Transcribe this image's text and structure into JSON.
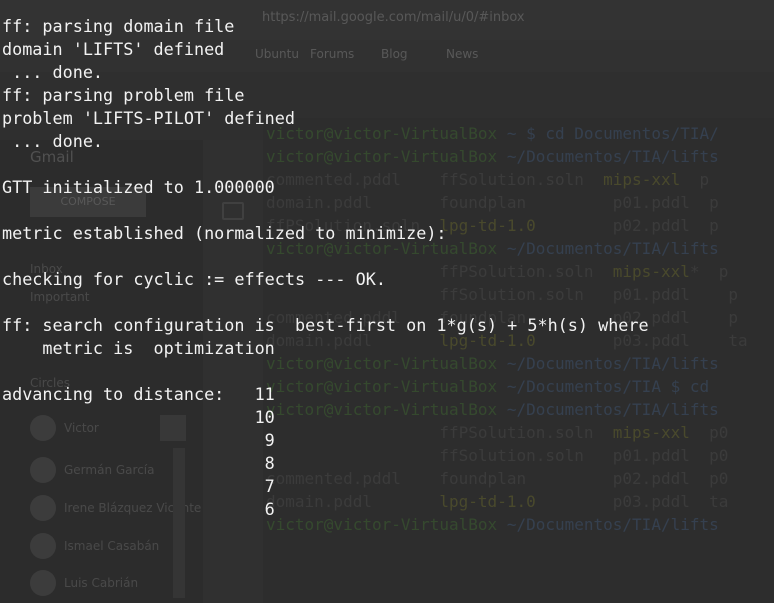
{
  "background": {
    "browser_url": "https://mail.google.com/mail/u/0/#inbox",
    "bookmarks": [
      "Ubuntu",
      "Forums",
      "Blog",
      "News"
    ],
    "gmail_label": "Gmail",
    "compose_label": "COMPOSE",
    "sidebar_items": [
      "Inbox",
      "Important"
    ],
    "circles_label": "Circles",
    "contacts": [
      "Victor",
      "Germán García",
      "Irene Blázquez Vicente",
      "Ismael Casabán",
      "Luis Cabrián"
    ],
    "ghost_terminal_lines": [
      {
        "segments": [
          {
            "t": "victor@victor-VirtualBox",
            "c": "p"
          },
          {
            "t": " ~ $ cd Documentos/TIA/",
            "c": "b"
          }
        ]
      },
      {
        "segments": [
          {
            "t": "victor@victor-VirtualBox",
            "c": "p"
          },
          {
            "t": " ~/Documentos/TIA/lifts",
            "c": "b"
          }
        ]
      },
      {
        "segments": [
          {
            "t": "commented.pddl    ffSolution.soln  ",
            "c": ""
          },
          {
            "t": "mips-xxl",
            "c": "y"
          },
          {
            "t": "  p",
            "c": ""
          }
        ]
      },
      {
        "segments": [
          {
            "t": "domain.pddl       foundplan         p01.pddl  p",
            "c": ""
          }
        ]
      },
      {
        "segments": [
          {
            "t": "ffPSolution.soln  ",
            "c": ""
          },
          {
            "t": "lpg-td-1.0",
            "c": "y"
          },
          {
            "t": "        p02.pddl  p",
            "c": ""
          }
        ]
      },
      {
        "segments": [
          {
            "t": "victor@victor-VirtualBox",
            "c": "p"
          },
          {
            "t": " ~/Documentos/TIA/lifts",
            "c": "b"
          }
        ]
      },
      {
        "segments": [
          {
            "t": "                  ffPSolution.soln  ",
            "c": ""
          },
          {
            "t": "mips-xxl",
            "c": "y"
          },
          {
            "t": "*  p",
            "c": ""
          }
        ]
      },
      {
        "segments": [
          {
            "t": "                  ffSolution.soln   p01.pddl    p",
            "c": ""
          }
        ]
      },
      {
        "segments": [
          {
            "t": "commented.pddl    foundplan         p02.pddl    p",
            "c": ""
          }
        ]
      },
      {
        "segments": [
          {
            "t": "domain.pddl       ",
            "c": ""
          },
          {
            "t": "lpg-td-1.0",
            "c": "y"
          },
          {
            "t": "        p03.pddl    ta",
            "c": ""
          }
        ]
      },
      {
        "segments": [
          {
            "t": "victor@victor-VirtualBox",
            "c": "p"
          },
          {
            "t": " ~/Documentos/TIA/lifts",
            "c": "b"
          }
        ]
      },
      {
        "segments": [
          {
            "t": "victor@victor-VirtualBox",
            "c": "p"
          },
          {
            "t": " ~/Documentos/TIA $ cd",
            "c": "b"
          }
        ]
      },
      {
        "segments": [
          {
            "t": "victor@victor-VirtualBox",
            "c": "p"
          },
          {
            "t": " ~/Documentos/TIA/lifts",
            "c": "b"
          }
        ]
      },
      {
        "segments": [
          {
            "t": "                  ffPSolution.soln  ",
            "c": ""
          },
          {
            "t": "mips-xxl",
            "c": "y"
          },
          {
            "t": "  p0",
            "c": ""
          }
        ]
      },
      {
        "segments": [
          {
            "t": "                  ffSolution.soln   p01.pddl  p0",
            "c": ""
          }
        ]
      },
      {
        "segments": [
          {
            "t": "commented.pddl    foundplan         p02.pddl  p0",
            "c": ""
          }
        ]
      },
      {
        "segments": [
          {
            "t": "domain.pddl       ",
            "c": ""
          },
          {
            "t": "lpg-td-1.0",
            "c": "y"
          },
          {
            "t": "        p03.pddl  ta",
            "c": ""
          }
        ]
      },
      {
        "segments": [
          {
            "t": "victor@victor-VirtualBox",
            "c": "p"
          },
          {
            "t": " ~/Documentos/TIA/lifts",
            "c": "b"
          }
        ]
      }
    ]
  },
  "terminal": {
    "lines": [
      "ff: parsing domain file",
      "domain 'LIFTS' defined",
      " ... done.",
      "ff: parsing problem file",
      "problem 'LIFTS-PILOT' defined",
      " ... done.",
      "",
      "GTT initialized to 1.000000",
      "",
      "metric established (normalized to minimize):",
      "",
      "checking for cyclic := effects --- OK.",
      "",
      "ff: search configuration is  best-first on 1*g(s) + 5*h(s) where",
      "    metric is  optimization",
      "",
      "advancing to distance:   11",
      "                         10",
      "                          9",
      "                          8",
      "                          7",
      "                          6"
    ]
  },
  "colors": {
    "terminal_bg": "#2f2f2f",
    "terminal_fg": "#f2f2f2"
  }
}
